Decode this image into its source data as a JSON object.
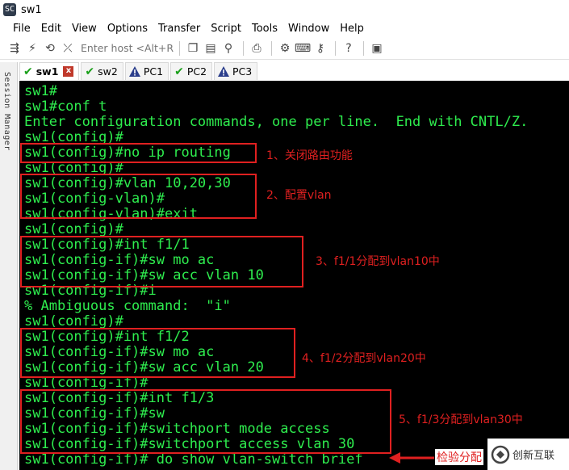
{
  "window": {
    "title": "sw1",
    "app_icon": "SC"
  },
  "menu": [
    "File",
    "Edit",
    "View",
    "Options",
    "Transfer",
    "Script",
    "Tools",
    "Window",
    "Help"
  ],
  "toolbar": {
    "host_placeholder": "Enter host <Alt+R>"
  },
  "tabs": [
    {
      "label": "sw1",
      "status": "connected",
      "active": true
    },
    {
      "label": "sw2",
      "status": "connected",
      "active": false
    },
    {
      "label": "PC1",
      "status": "warning",
      "active": false
    },
    {
      "label": "PC2",
      "status": "connected",
      "active": false
    },
    {
      "label": "PC3",
      "status": "warning",
      "active": false
    }
  ],
  "side_panel": {
    "label": "Session Manager"
  },
  "terminal": {
    "lines": [
      "sw1#",
      "sw1#conf t",
      "Enter configuration commands, one per line.  End with CNTL/Z.",
      "sw1(config)#",
      "sw1(config)#no ip routing",
      "sw1(config)#",
      "sw1(config)#vlan 10,20,30",
      "sw1(config-vlan)#",
      "sw1(config-vlan)#exit",
      "sw1(config)#",
      "sw1(config)#int f1/1",
      "sw1(config-if)#sw mo ac",
      "sw1(config-if)#sw acc vlan 10",
      "sw1(config-if)#i",
      "% Ambiguous command:  \"i\"",
      "sw1(config)#",
      "sw1(config)#int f1/2",
      "sw1(config-if)#sw mo ac",
      "sw1(config-if)#sw acc vlan 20",
      "sw1(config-if)#",
      "sw1(config-if)#int f1/3",
      "sw1(config-if)#sw",
      "sw1(config-if)#switchport mode access",
      "sw1(config-if)#switchport access vlan 30",
      "sw1(config-if)# do show vlan-switch brief"
    ]
  },
  "annotations": [
    "1、关闭路由功能",
    "2、配置vlan",
    "3、f1/1分配到vlan10中",
    "4、f1/2分配到vlan20中",
    "5、f1/3分配到vlan30中",
    "检验分配"
  ],
  "watermark": {
    "text": "创新互联"
  },
  "colors": {
    "terminal_bg": "#000000",
    "terminal_fg": "#2eed4e",
    "annotation": "#e02020"
  }
}
